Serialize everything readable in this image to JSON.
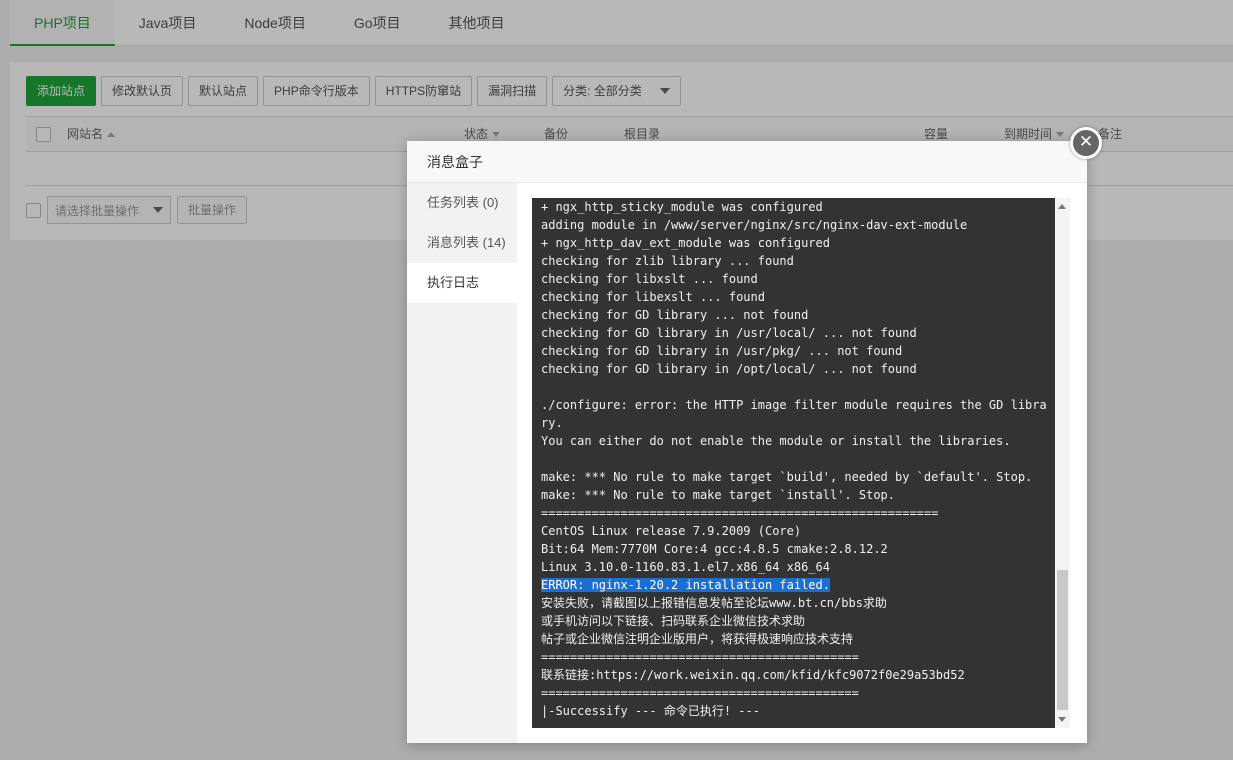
{
  "tabs": [
    {
      "label": "PHP项目",
      "active": true
    },
    {
      "label": "Java项目"
    },
    {
      "label": "Node项目"
    },
    {
      "label": "Go项目"
    },
    {
      "label": "其他项目"
    }
  ],
  "toolbar": {
    "add_site": "添加站点",
    "default_page": "修改默认页",
    "default_site": "默认站点",
    "php_cli": "PHP命令行版本",
    "https_guard": "HTTPS防窜站",
    "vuln_scan": "漏洞扫描",
    "category_select": "分类: 全部分类"
  },
  "table": {
    "headers": {
      "site_name": "网站名",
      "status": "状态",
      "backup": "备份",
      "root_dir": "根目录",
      "capacity": "容量",
      "expire": "到期时间",
      "note": "备注"
    },
    "batch_placeholder": "请选择批量操作",
    "batch_button": "批量操作"
  },
  "modal": {
    "title": "消息盒子",
    "close_icon": "close-icon",
    "side": [
      {
        "label": "任务列表 (0)"
      },
      {
        "label": "消息列表 (14)"
      },
      {
        "label": "执行日志",
        "active": true
      }
    ],
    "log_lines": [
      "+ ngx_http_sticky_module was configured",
      "adding module in /www/server/nginx/src/nginx-dav-ext-module",
      "+ ngx_http_dav_ext_module was configured",
      "checking for zlib library ... found",
      "checking for libxslt ... found",
      "checking for libexslt ... found",
      "checking for GD library ... not found",
      "checking for GD library in /usr/local/ ... not found",
      "checking for GD library in /usr/pkg/ ... not found",
      "checking for GD library in /opt/local/ ... not found",
      "",
      "./configure: error: the HTTP image filter module requires the GD libra",
      "ry.",
      "You can either do not enable the module or install the libraries.",
      "",
      "make: *** No rule to make target `build', needed by `default'. Stop.",
      "make: *** No rule to make target `install'. Stop.",
      "=======================================================",
      "CentOS Linux release 7.9.2009 (Core)",
      "Bit:64 Mem:7770M Core:4 gcc:4.8.5 cmake:2.8.12.2",
      "Linux 3.10.0-1160.83.1.el7.x86_64 x86_64",
      "ERROR: nginx-1.20.2 installation failed.",
      "安装失败，请截图以上报错信息发帖至论坛www.bt.cn/bbs求助",
      "或手机访问以下链接、扫码联系企业微信技术求助",
      "帖子或企业微信注明企业版用户，将获得极速响应技术支持",
      "============================================",
      "联系链接:https://work.weixin.qq.com/kfid/kfc9072f0e29a53bd52",
      "============================================",
      "|-Successify --- 命令已执行! ---"
    ],
    "highlighted_line": "ERROR: nginx-1.20.2 installation failed."
  }
}
